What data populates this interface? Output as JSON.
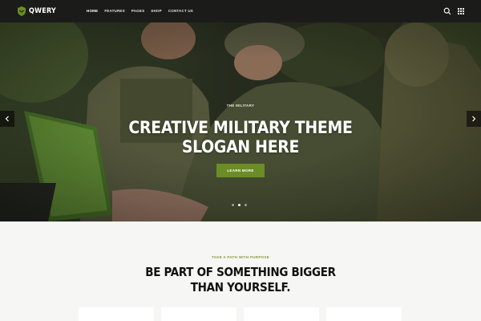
{
  "brand": {
    "name": "QWERY",
    "accent": "#6b8c26"
  },
  "nav": {
    "items": [
      {
        "label": "HOME",
        "active": true
      },
      {
        "label": "FEATURES",
        "active": false
      },
      {
        "label": "PAGES",
        "active": false
      },
      {
        "label": "SHOP",
        "active": false
      },
      {
        "label": "CONTACT US",
        "active": false
      }
    ],
    "search_icon": "search-icon",
    "menu_icon": "grid-menu-icon"
  },
  "hero": {
    "kicker": "THE MILITARY",
    "title_line1": "CREATIVE MILITARY THEME",
    "title_line2": "SLOGAN HERE",
    "button_label": "LEARN MORE",
    "slides": 3,
    "active_slide": 2
  },
  "section": {
    "kicker": "TAKE A PATH WITH PURPOSE",
    "title_line1": "BE PART OF SOMETHING BIGGER",
    "title_line2": "THAN YOURSELF."
  }
}
